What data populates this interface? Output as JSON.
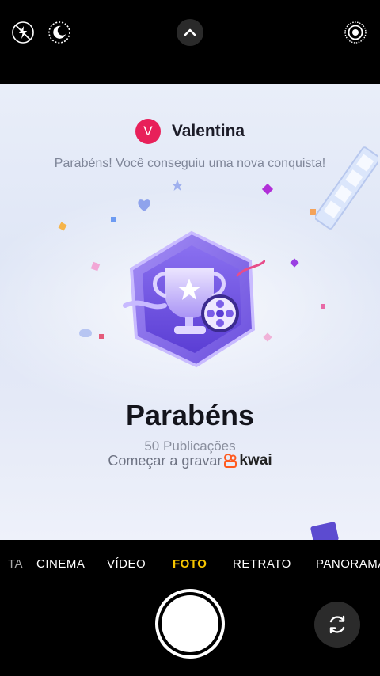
{
  "top_bar": {
    "icons": [
      "flash-off-icon",
      "night-mode-icon",
      "chevron-up-icon",
      "live-photo-icon"
    ]
  },
  "achievement": {
    "user_initial": "V",
    "user_name": "Valentina",
    "subtitle": "Parabéns! Você conseguiu uma nova conquista!",
    "title": "Parabéns",
    "publications": "50 Publicações",
    "record_text": "Começar a gravar",
    "brand": "kwai",
    "colors": {
      "avatar": "#e8205a",
      "badge_primary": "#8b6cf0",
      "badge_dark": "#5a3fd6"
    }
  },
  "modes": {
    "items": [
      "TA",
      "CINEMA",
      "VÍDEO",
      "FOTO",
      "RETRATO",
      "PANORAMA"
    ],
    "active": "FOTO",
    "active_color": "#f7c600"
  },
  "bottom": {
    "icons": [
      "shutter-button",
      "flip-camera-icon"
    ]
  }
}
